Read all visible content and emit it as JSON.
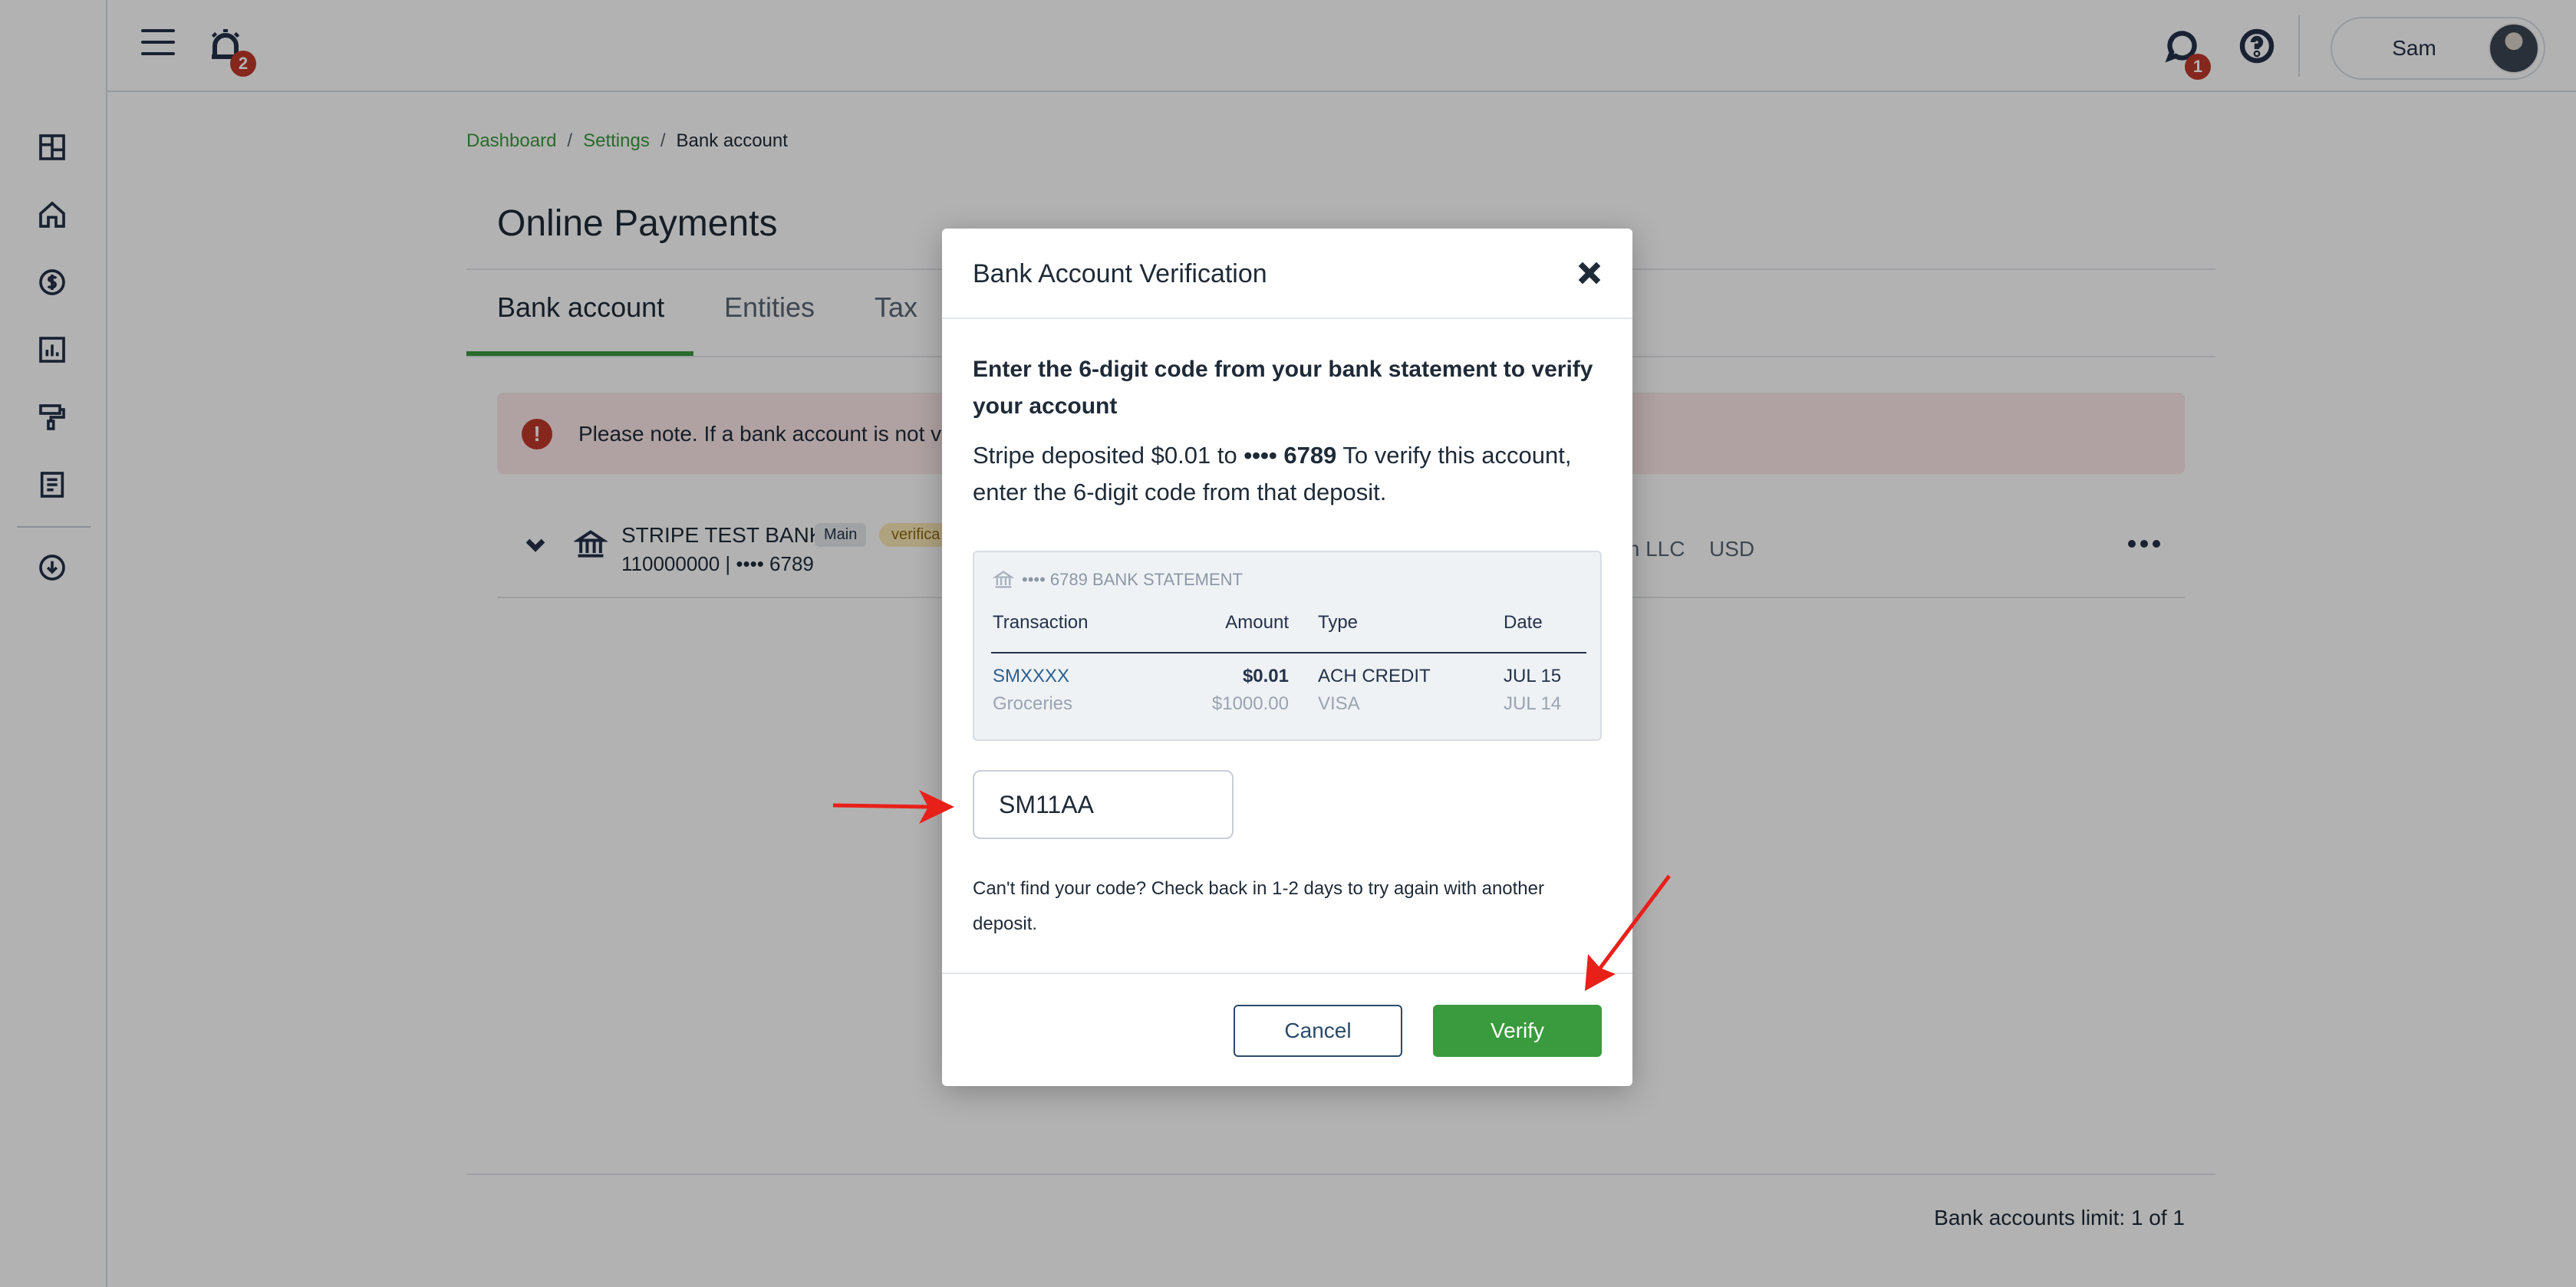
{
  "topbar": {
    "notification_count": "2",
    "message_count": "1",
    "user_name": "Sam"
  },
  "breadcrumb": {
    "dashboard": "Dashboard",
    "settings": "Settings",
    "current": "Bank account",
    "separator": "/"
  },
  "page": {
    "title": "Online Payments",
    "tabs": [
      "Bank account",
      "Entities",
      "Tax"
    ],
    "alert_text": "Please note. If a bank account is not ve",
    "bank_name": "STRIPE TEST BANK",
    "main_badge": "Main",
    "status_badge": "verifica",
    "bank_number": "110000000 | •••• 6789",
    "entity": "m LLC",
    "currency": "USD",
    "limit_text": "Bank accounts limit: 1 of 1"
  },
  "modal": {
    "title": "Bank Account Verification",
    "heading": "Enter the 6-digit code from your bank statement to verify your account",
    "desc_prefix": "Stripe deposited $0.01 to ",
    "desc_account": "•••• 6789",
    "desc_suffix": " To verify this account, enter the 6-digit code from that deposit.",
    "statement": {
      "title": "•••• 6789 BANK STATEMENT",
      "headers": [
        "Transaction",
        "Amount",
        "Type",
        "Date"
      ],
      "rows": [
        [
          "SMXXXX",
          "$0.01",
          "ACH CREDIT",
          "JUL 15"
        ],
        [
          "Groceries",
          "$1000.00",
          "VISA",
          "JUL 14"
        ]
      ]
    },
    "code_value": "SM11AA",
    "help_text": "Can't find your code? Check back in 1-2 days to try again with another deposit.",
    "cancel_label": "Cancel",
    "verify_label": "Verify"
  },
  "colors": {
    "accent_green": "#3a9a3e",
    "annotation_red": "#e8201a",
    "badge_red": "#c0392b"
  }
}
